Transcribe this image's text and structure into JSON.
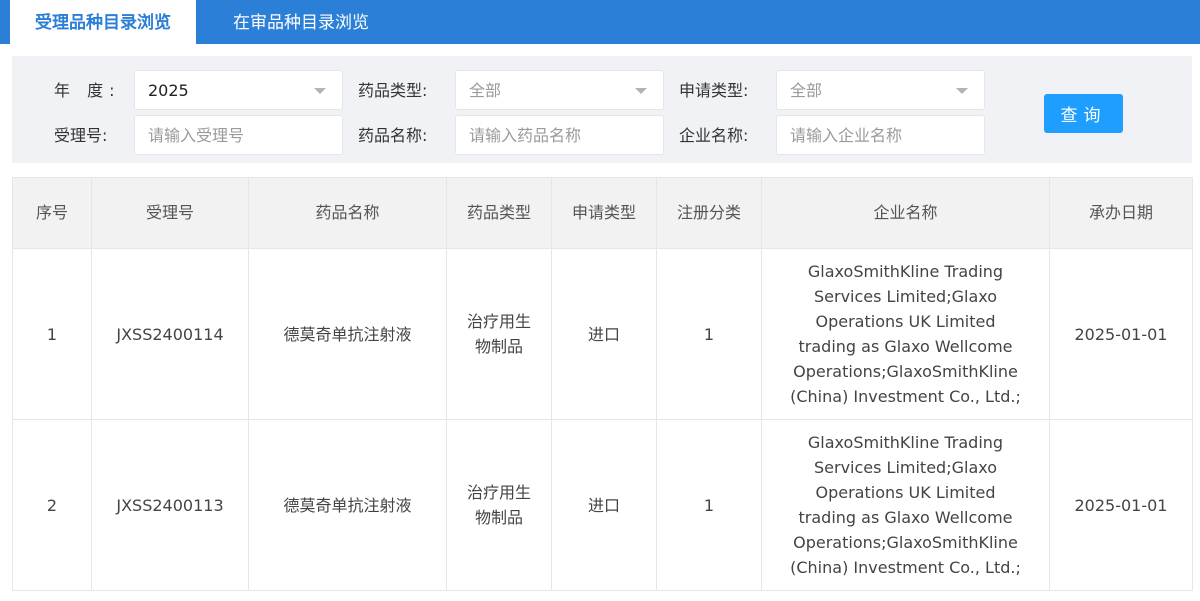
{
  "tabs": [
    {
      "label": "受理品种目录浏览",
      "active": true
    },
    {
      "label": "在审品种目录浏览",
      "active": false
    }
  ],
  "filters": {
    "year_label": "年 度:",
    "year_value": "2025",
    "drug_type_label": "药品类型:",
    "drug_type_value": "全部",
    "apply_type_label": "申请类型:",
    "apply_type_value": "全部",
    "accept_no_label": "受理号:",
    "accept_no_placeholder": "请输入受理号",
    "drug_name_label": "药品名称:",
    "drug_name_placeholder": "请输入药品名称",
    "company_label": "企业名称:",
    "company_placeholder": "请输入企业名称",
    "query_label": "查询"
  },
  "table": {
    "headers": [
      "序号",
      "受理号",
      "药品名称",
      "药品类型",
      "申请类型",
      "注册分类",
      "企业名称",
      "承办日期"
    ],
    "rows": [
      [
        "1",
        "JXSS2400114",
        "德莫奇单抗注射液",
        "治疗用生物制品",
        "进口",
        "1",
        "GlaxoSmithKline Trading Services Limited;Glaxo Operations UK Limited trading as Glaxo Wellcome Operations;GlaxoSmithKline (China) Investment Co., Ltd.;",
        "2025-01-01"
      ],
      [
        "2",
        "JXSS2400113",
        "德莫奇单抗注射液",
        "治疗用生物制品",
        "进口",
        "1",
        "GlaxoSmithKline Trading Services Limited;Glaxo Operations UK Limited trading as Glaxo Wellcome Operations;GlaxoSmithKline (China) Investment Co., Ltd.;",
        "2025-01-01"
      ]
    ]
  },
  "colors": {
    "tab_bar": "#2b7fd6",
    "button": "#1e9fff",
    "panel": "#f0f2f5"
  }
}
